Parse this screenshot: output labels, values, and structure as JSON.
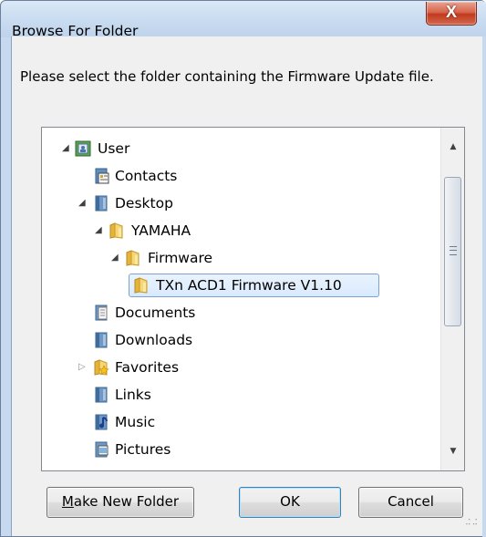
{
  "window": {
    "title": "Browse For Folder",
    "close_label": "X"
  },
  "instruction": "Please select the folder containing the Firmware Update file.",
  "tree": {
    "items": [
      {
        "label": "User",
        "expanded": true,
        "icon": "user-folder-icon"
      },
      {
        "label": "Contacts",
        "icon": "contacts-folder-icon"
      },
      {
        "label": "Desktop",
        "expanded": true,
        "icon": "desktop-folder-icon"
      },
      {
        "label": "YAMAHA",
        "expanded": true,
        "icon": "folder-icon"
      },
      {
        "label": "Firmware",
        "expanded": true,
        "icon": "folder-icon"
      },
      {
        "label": "TXn ACD1 Firmware V1.10",
        "selected": true,
        "icon": "folder-icon"
      },
      {
        "label": "Documents",
        "icon": "documents-folder-icon"
      },
      {
        "label": "Downloads",
        "icon": "downloads-folder-icon"
      },
      {
        "label": "Favorites",
        "expanded": false,
        "icon": "favorites-folder-icon"
      },
      {
        "label": "Links",
        "icon": "links-folder-icon"
      },
      {
        "label": "Music",
        "icon": "music-folder-icon"
      },
      {
        "label": "Pictures",
        "icon": "pictures-folder-icon"
      }
    ]
  },
  "buttons": {
    "new_folder_label": "Make New Folder",
    "new_folder_underline": "M",
    "new_folder_rest": "ake New Folder",
    "ok_label": "OK",
    "cancel_label": "Cancel"
  },
  "colors": {
    "title_bg": "#c8dbf0",
    "close_red": "#c23a1f",
    "selection_border": "#7da2ce",
    "selection_fill": "#d9eafd",
    "folder_yellow": "#f3cf5e"
  }
}
